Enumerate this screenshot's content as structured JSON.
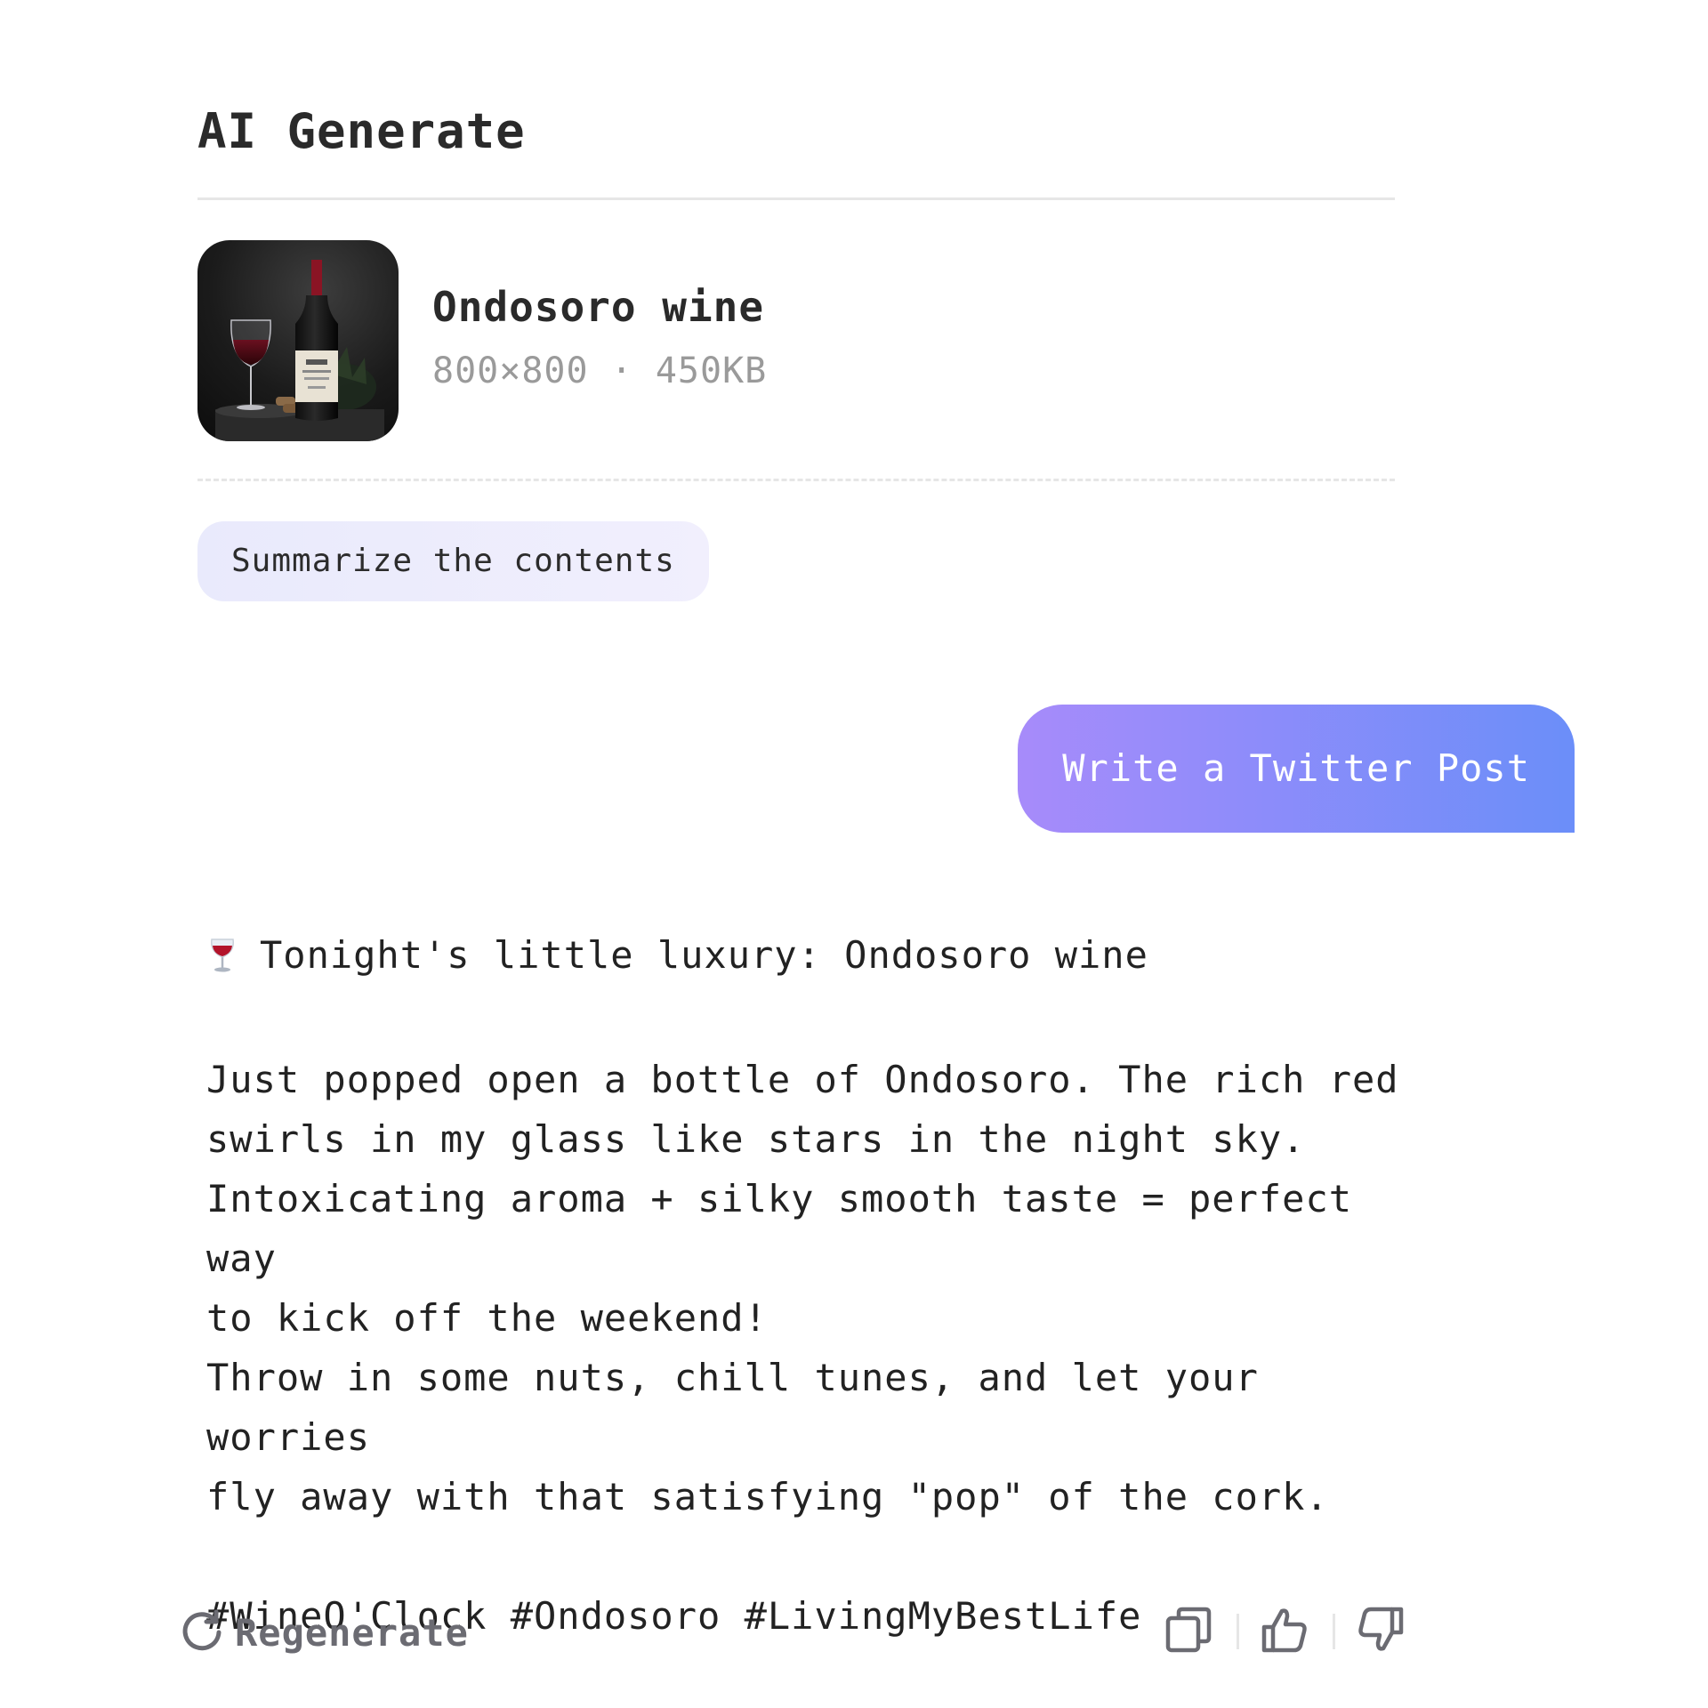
{
  "panel": {
    "title": "AI Generate"
  },
  "file": {
    "name": "Ondosoro wine",
    "meta": "800×800 · 450KB",
    "thumbnail_icon": "wine-bottle-photo"
  },
  "suggestions": [
    {
      "label": "Summarize the contents"
    }
  ],
  "user_message": {
    "text": "Write a Twitter Post"
  },
  "reply": {
    "icon": "wine-glass-icon",
    "headline": "Tonight's little luxury: Ondosoro wine",
    "body_lines": [
      "Just popped open a bottle of Ondosoro. The rich red",
      "swirls in my glass like stars in the night sky.",
      "Intoxicating aroma + silky smooth taste = perfect way",
      "to kick off the weekend!",
      "Throw in some nuts, chill tunes, and let your worries",
      "fly away with that satisfying \"pop\" of the cork."
    ],
    "hashtags": "#WineO'Clock #Ondosoro #LivingMyBestLife"
  },
  "actions": {
    "regenerate_label": "Regenerate",
    "regenerate_icon": "refresh-icon",
    "copy_icon": "copy-icon",
    "like_icon": "thumbs-up-icon",
    "dislike_icon": "thumbs-down-icon"
  },
  "colors": {
    "accent_gradient_start": "#a78bfa",
    "accent_gradient_end": "#6b8ef9",
    "chip_background": "#e9eafc",
    "icon_gray": "#6b6b72",
    "meta_gray": "#9a9a9a"
  }
}
